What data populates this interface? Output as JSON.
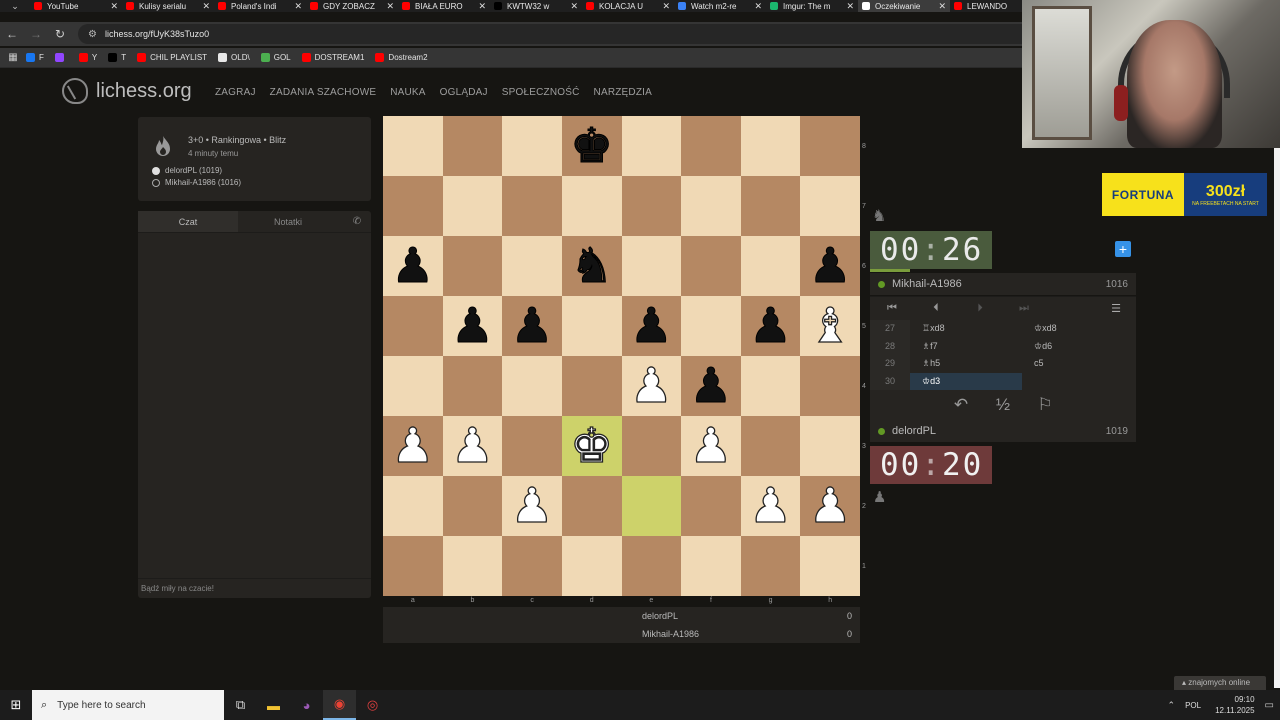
{
  "browser": {
    "tabs": [
      {
        "label": "YouTube",
        "color": "#ff0000"
      },
      {
        "label": "Kulisy serialu",
        "color": "#ff0000"
      },
      {
        "label": "Poland's Indi",
        "color": "#ff0000"
      },
      {
        "label": "GDY ZOBACZ",
        "color": "#ff0000"
      },
      {
        "label": "BIAŁA EURO",
        "color": "#ff0000"
      },
      {
        "label": "KWTW32 w",
        "color": "#000000"
      },
      {
        "label": "KOLACJA U",
        "color": "#ff0000"
      },
      {
        "label": "Watch m2-re",
        "color": "#3b82f6"
      },
      {
        "label": "Imgur: The m",
        "color": "#1bb76e"
      },
      {
        "label": "Oczekiwanie",
        "color": "#ffffff"
      },
      {
        "label": "LEWANDO",
        "color": "#ff0000"
      }
    ],
    "active_tab": 9,
    "url": "lichess.org/fUyK38sTuzo0",
    "bookmarks": [
      {
        "label": "F",
        "color": "#1877f2"
      },
      {
        "label": "",
        "color": "#9146ff"
      },
      {
        "label": "Y",
        "color": "#ff0000"
      },
      {
        "label": "T",
        "color": "#000000"
      },
      {
        "label": "CHIL PLAYLIST",
        "color": "#ff0000"
      },
      {
        "label": "OLD\\",
        "color": "#e8e8e8"
      },
      {
        "label": "GOL",
        "color": "#4caf50"
      },
      {
        "label": "DOSTREAM1",
        "color": "#ff0000"
      },
      {
        "label": "Dostream2",
        "color": "#ff0000"
      }
    ]
  },
  "site": {
    "logo": "lichess.org",
    "nav": [
      "ZAGRAJ",
      "ZADANIA SZACHOWE",
      "NAUKA",
      "OGLĄDAJ",
      "SPOŁECZNOŚĆ",
      "NARZĘDZIA"
    ]
  },
  "game_meta": {
    "title": "3+0 • Rankingowa • Blitz",
    "when": "4 minuty temu",
    "white": "delordPL (1019)",
    "black": "Mikhail-A1986 (1016)"
  },
  "chat": {
    "tab_chat": "Czat",
    "tab_notes": "Notatki",
    "placeholder": "Bądź miły na czacie!"
  },
  "board": {
    "highlight": [
      "d3",
      "e2"
    ],
    "pieces": [
      {
        "sq": "d8",
        "color": "b",
        "glyph": "♚"
      },
      {
        "sq": "a6",
        "color": "b",
        "glyph": "♟"
      },
      {
        "sq": "d6",
        "color": "b",
        "glyph": "♞"
      },
      {
        "sq": "h6",
        "color": "b",
        "glyph": "♟"
      },
      {
        "sq": "b5",
        "color": "b",
        "glyph": "♟"
      },
      {
        "sq": "c5",
        "color": "b",
        "glyph": "♟"
      },
      {
        "sq": "e5",
        "color": "b",
        "glyph": "♟"
      },
      {
        "sq": "g5",
        "color": "b",
        "glyph": "♟"
      },
      {
        "sq": "h5",
        "color": "w",
        "glyph": "♝"
      },
      {
        "sq": "e4",
        "color": "w",
        "glyph": "♟"
      },
      {
        "sq": "f4",
        "color": "b",
        "glyph": "♟"
      },
      {
        "sq": "a3",
        "color": "w",
        "glyph": "♟"
      },
      {
        "sq": "b3",
        "color": "w",
        "glyph": "♟"
      },
      {
        "sq": "d3",
        "color": "w",
        "glyph": "♚"
      },
      {
        "sq": "f3",
        "color": "w",
        "glyph": "♟"
      },
      {
        "sq": "c2",
        "color": "w",
        "glyph": "♟"
      },
      {
        "sq": "g2",
        "color": "w",
        "glyph": "♟"
      },
      {
        "sq": "h2",
        "color": "w",
        "glyph": "♟"
      }
    ],
    "files": [
      "a",
      "b",
      "c",
      "d",
      "e",
      "f",
      "g",
      "h"
    ],
    "ranks": [
      "8",
      "7",
      "6",
      "5",
      "4",
      "3",
      "2",
      "1"
    ]
  },
  "material": {
    "white_name": "delordPL",
    "white_score": "0",
    "black_name": "Mikhail-A1986",
    "black_score": "0"
  },
  "clocks": {
    "top": {
      "min": "00",
      "sec": "26"
    },
    "bottom": {
      "min": "00",
      "sec": "20"
    }
  },
  "players": {
    "top": {
      "name": "Mikhail-A1986",
      "rating": "1016"
    },
    "bottom": {
      "name": "delordPL",
      "rating": "1019"
    }
  },
  "moves": [
    {
      "n": "27",
      "w": "♖xd8",
      "b": "♔xd8"
    },
    {
      "n": "28",
      "w": "♗f7",
      "b": "♔d6"
    },
    {
      "n": "29",
      "w": "♗h5",
      "b": "c5"
    },
    {
      "n": "30",
      "w": "♔d3",
      "b": ""
    }
  ],
  "active_move": "30w",
  "actions": {
    "takeback": "↶",
    "draw": "½",
    "resign": "⚐"
  },
  "ad": {
    "brand": "FORTUNA",
    "amount": "300zł",
    "sub": "NA FREEBETACH NA START"
  },
  "friends": "znajomych online",
  "taskbar": {
    "search": "Type here to search",
    "lang": "POL",
    "time": "09:10",
    "date": "12.11.2025"
  }
}
